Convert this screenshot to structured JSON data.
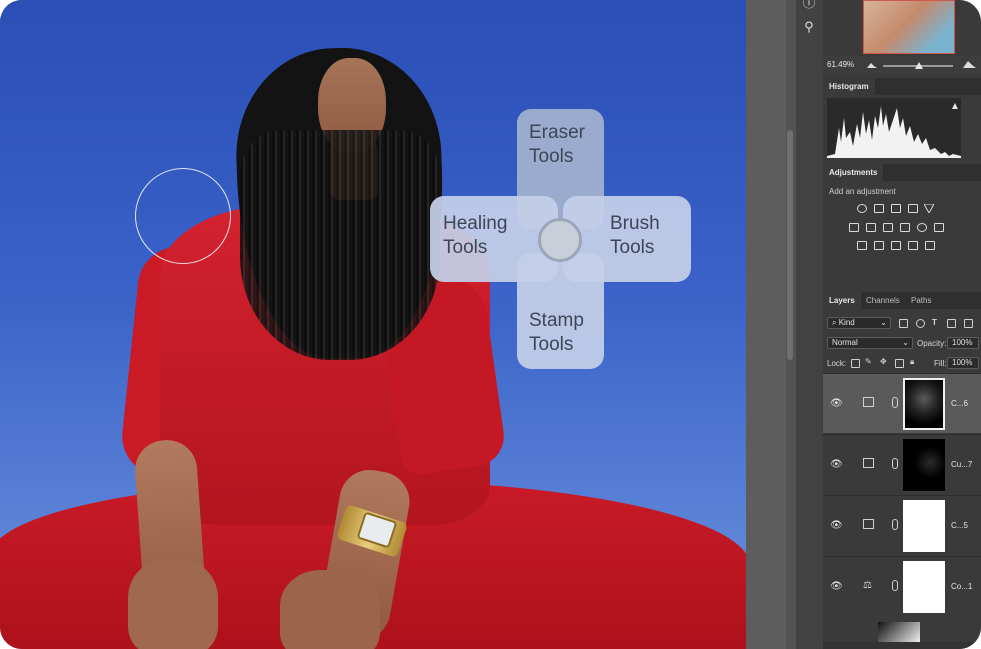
{
  "tool_menu": {
    "eraser": [
      "Eraser",
      "Tools"
    ],
    "healing": [
      "Healing",
      "Tools"
    ],
    "brush": [
      "Brush",
      "Tools"
    ],
    "stamp": [
      "Stamp",
      "Tools"
    ]
  },
  "navigator": {
    "zoom": "61.49%"
  },
  "histogram": {
    "tab": "Histogram",
    "warning_icon": "warning-icon"
  },
  "adjustments": {
    "tab": "Adjustments",
    "label": "Add an adjustment",
    "icons": [
      "brightness-contrast-icon",
      "levels-icon",
      "curves-icon",
      "exposure-icon",
      "vibrance-icon",
      "hue-saturation-icon",
      "color-balance-icon",
      "black-white-icon",
      "photo-filter-icon",
      "channel-mixer-icon",
      "color-lookup-icon",
      "invert-icon",
      "posterize-icon",
      "threshold-icon",
      "selective-color-icon",
      "gradient-map-icon"
    ]
  },
  "layers": {
    "tabs": [
      "Layers",
      "Channels",
      "Paths"
    ],
    "filter_kind": "Kind",
    "blend_mode": "Normal",
    "opacity_label": "Opacity:",
    "opacity_value": "100%",
    "lock_label": "Lock:",
    "fill_label": "Fill:",
    "fill_value": "100%",
    "rows": [
      {
        "name": "C...6",
        "selected": true,
        "mask": "dark-figure"
      },
      {
        "name": "Cu...7",
        "selected": false,
        "mask": "dark"
      },
      {
        "name": "C...5",
        "selected": false,
        "mask": "white"
      },
      {
        "name": "Co...1",
        "selected": false,
        "mask": "white"
      }
    ]
  },
  "colors": {
    "sky": "#2a4fb7",
    "outfit_red": "#c91a26",
    "panel_bg": "#3a3a3a",
    "menu_petal": "#c4d0e8"
  }
}
